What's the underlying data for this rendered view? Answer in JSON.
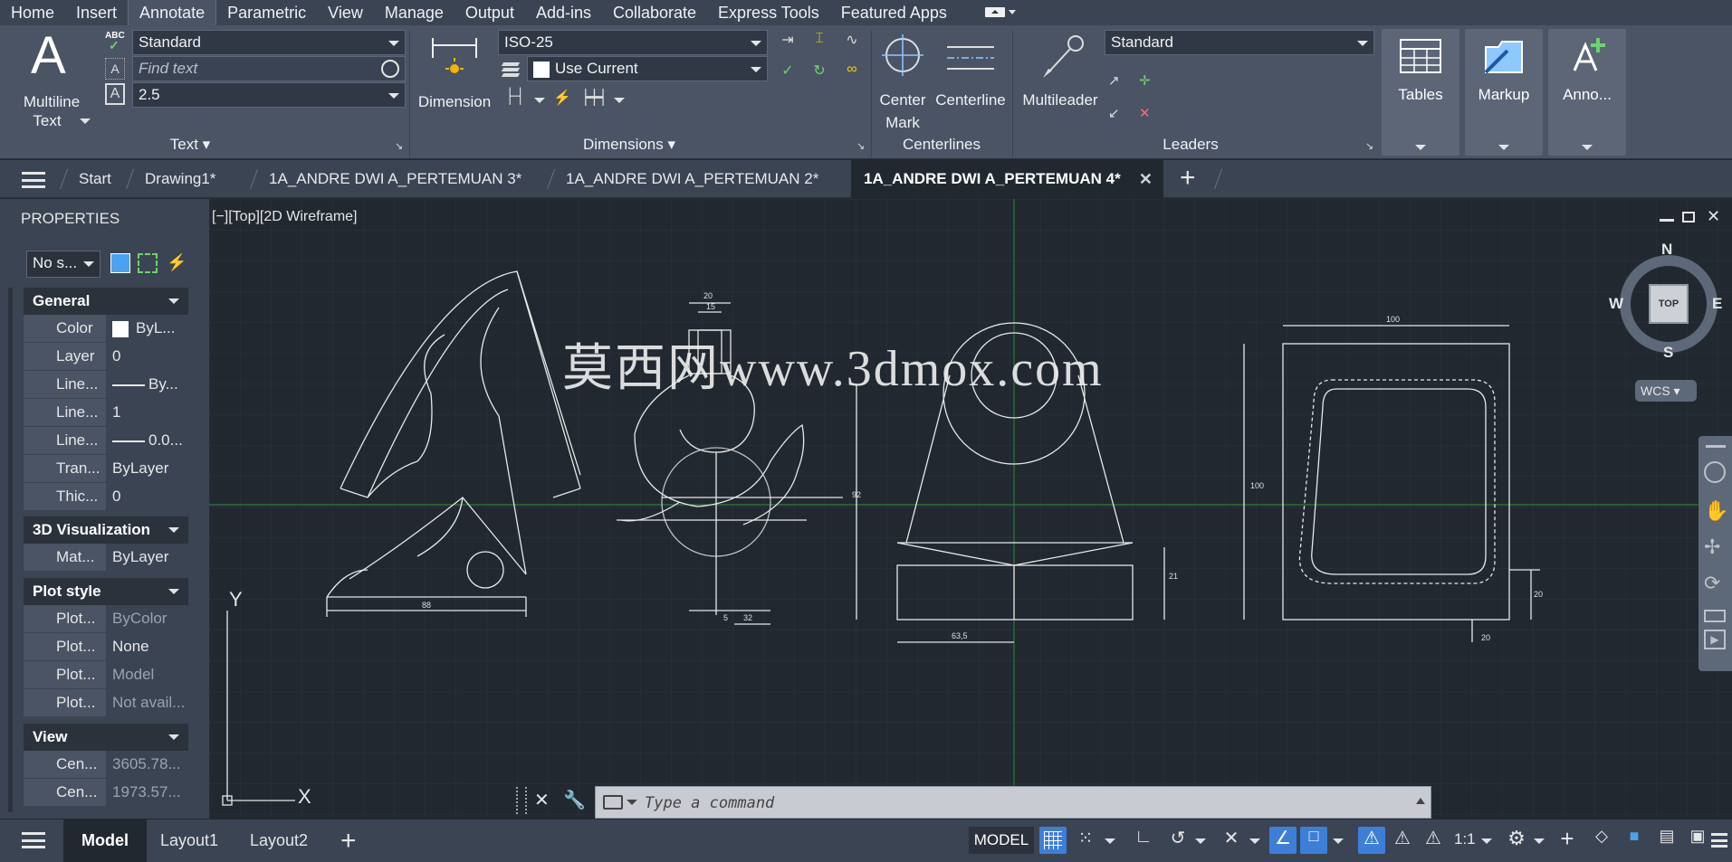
{
  "menu": {
    "tabs": [
      "Home",
      "Insert",
      "Annotate",
      "Parametric",
      "View",
      "Manage",
      "Output",
      "Add-ins",
      "Collaborate",
      "Express Tools",
      "Featured Apps"
    ],
    "active": "Annotate"
  },
  "ribbon": {
    "text_panel": {
      "multiline_text_label": "Multiline",
      "multiline_text_label2": "Text",
      "text_style": "Standard",
      "find_text_placeholder": "Find text",
      "text_height": "2.5",
      "panel_title": "Text"
    },
    "dimensions_panel": {
      "dimension_label": "Dimension",
      "dim_style": "ISO-25",
      "dim_layer": "Use Current",
      "panel_title": "Dimensions"
    },
    "centerlines_panel": {
      "center_mark_label": "Center",
      "center_mark_label2": "Mark",
      "centerline_label": "Centerline",
      "panel_title": "Centerlines"
    },
    "leaders_panel": {
      "multileader_label": "Multileader",
      "mleader_style": "Standard",
      "panel_title": "Leaders"
    },
    "tables_label": "Tables",
    "markup_label": "Markup",
    "anno_label": "Anno..."
  },
  "file_tabs": {
    "start": "Start",
    "tabs": [
      "Drawing1*",
      "1A_ANDRE DWI A_PERTEMUAN 3*",
      "1A_ANDRE DWI A_PERTEMUAN 2*"
    ],
    "active": "1A_ANDRE DWI A_PERTEMUAN 4*"
  },
  "properties": {
    "title": "PROPERTIES",
    "selection": "No s...",
    "sections": {
      "general": "General",
      "vis3d": "3D Visualization",
      "plot": "Plot style",
      "view": "View"
    },
    "general_rows": [
      {
        "key": "Color",
        "value": "ByL..."
      },
      {
        "key": "Layer",
        "value": "0"
      },
      {
        "key": "Line...",
        "value": "By..."
      },
      {
        "key": "Line...",
        "value": "1"
      },
      {
        "key": "Line...",
        "value": "0.0..."
      },
      {
        "key": "Tran...",
        "value": "ByLayer"
      },
      {
        "key": "Thic...",
        "value": "0"
      }
    ],
    "vis3d_rows": [
      {
        "key": "Mat...",
        "value": "ByLayer"
      }
    ],
    "plot_rows": [
      {
        "key": "Plot...",
        "value": "ByColor"
      },
      {
        "key": "Plot...",
        "value": "None"
      },
      {
        "key": "Plot...",
        "value": "Model"
      },
      {
        "key": "Plot...",
        "value": "Not avail..."
      }
    ],
    "view_rows": [
      {
        "key": "Cen...",
        "value": "3605.78..."
      },
      {
        "key": "Cen...",
        "value": "1973.57..."
      }
    ]
  },
  "viewport": {
    "label": "[−][Top][2D Wireframe]",
    "viewcube_face": "TOP",
    "compass": {
      "n": "N",
      "s": "S",
      "e": "E",
      "w": "W"
    },
    "wcs": "WCS",
    "ucs_x": "X",
    "ucs_y": "Y",
    "watermark": "莫西网www.3dmox.com"
  },
  "drawing_dims": {
    "d1": "88",
    "d2": "20",
    "d3": "15",
    "d4": "32",
    "d5": "5",
    "d6": "63,5",
    "d7": "21",
    "d8": "100",
    "d9": "20",
    "d10": "20",
    "d11": "92",
    "d12": "100"
  },
  "command": {
    "placeholder": "Type a command"
  },
  "status": {
    "tabs": [
      "Layout1",
      "Layout2"
    ],
    "active_tab": "Model",
    "mode": "MODEL",
    "scale": "1:1"
  }
}
